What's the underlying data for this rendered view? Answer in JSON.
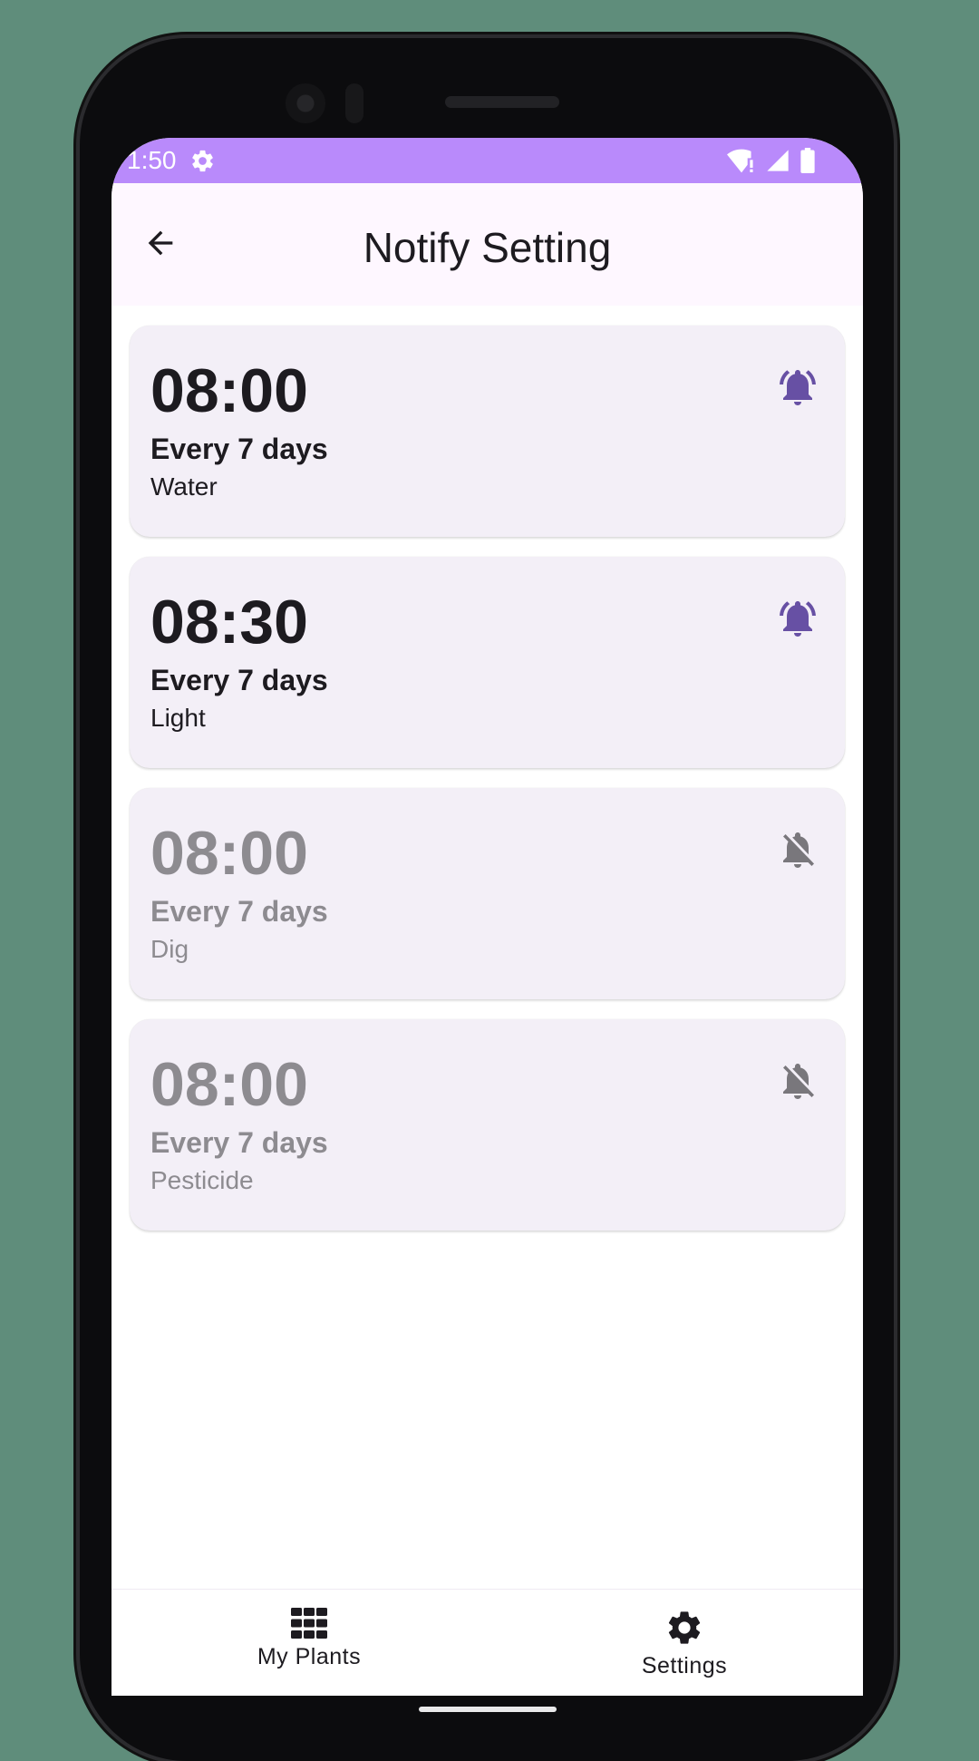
{
  "status_bar": {
    "time": "1:50",
    "background": "#b98afb",
    "icons": [
      "gear-icon",
      "wifi-icon",
      "signal-icon",
      "battery-icon"
    ]
  },
  "app_bar": {
    "title": "Notify Setting",
    "back_icon": "arrow-back-icon"
  },
  "colors": {
    "accent": "#6750a4",
    "card_bg": "#f3eff7",
    "disabled_text": "#8d8b90",
    "disabled_icon": "#79777c"
  },
  "alarms": [
    {
      "time": "08:00",
      "frequency": "Every 7 days",
      "task": "Water",
      "enabled": true,
      "icon": "bell-ringing-icon"
    },
    {
      "time": "08:30",
      "frequency": "Every 7 days",
      "task": "Light",
      "enabled": true,
      "icon": "bell-ringing-icon"
    },
    {
      "time": "08:00",
      "frequency": "Every 7 days",
      "task": "Dig",
      "enabled": false,
      "icon": "bell-off-icon"
    },
    {
      "time": "08:00",
      "frequency": "Every 7 days",
      "task": "Pesticide",
      "enabled": false,
      "icon": "bell-off-icon"
    }
  ],
  "bottom_nav": {
    "items": [
      {
        "label": "My Plants",
        "icon": "grid-icon"
      },
      {
        "label": "Settings",
        "icon": "gear-icon"
      }
    ]
  }
}
